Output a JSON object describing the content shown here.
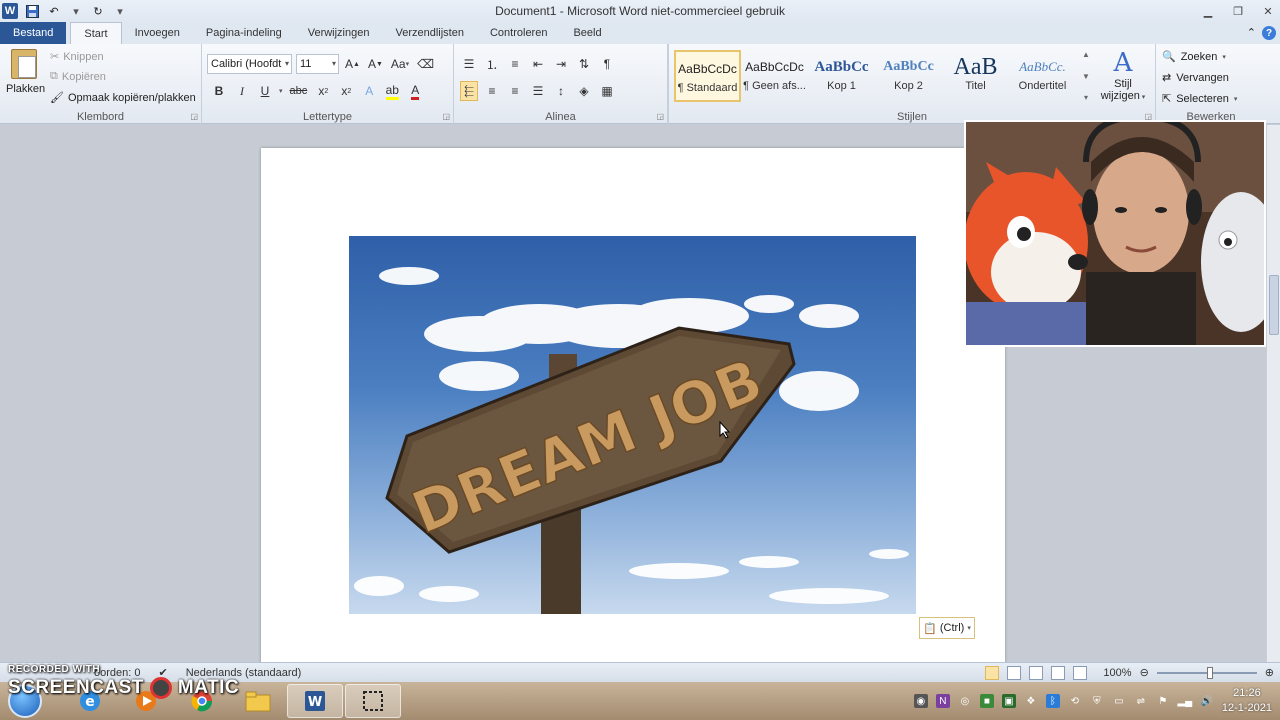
{
  "titlebar": {
    "title": "Document1  -  Microsoft Word niet-commercieel gebruik",
    "logo_letter": "W"
  },
  "tabs": [
    {
      "label": "Bestand"
    },
    {
      "label": "Start"
    },
    {
      "label": "Invoegen"
    },
    {
      "label": "Pagina-indeling"
    },
    {
      "label": "Verwijzingen"
    },
    {
      "label": "Verzendlijsten"
    },
    {
      "label": "Controleren"
    },
    {
      "label": "Beeld"
    }
  ],
  "clipboard": {
    "paste": "Plakken",
    "cut": "Knippen",
    "copy": "Kopiëren",
    "format_painter": "Opmaak kopiëren/plakken",
    "group_label": "Klembord"
  },
  "font": {
    "name": "Calibri (Hoofdt",
    "size": "11",
    "group_label": "Lettertype",
    "change_case": "Aa",
    "bold": "B",
    "italic": "I",
    "underline": "U",
    "strikethrough": "abc",
    "subscript": "x",
    "superscript": "x"
  },
  "paragraph": {
    "group_label": "Alinea",
    "pilcrow": "¶"
  },
  "styles": {
    "group_label": "Stijlen",
    "items": [
      {
        "sample": "AaBbCcDc",
        "name": "¶ Standaard"
      },
      {
        "sample": "AaBbCcDc",
        "name": "¶ Geen afs..."
      },
      {
        "sample": "AaBbCc",
        "name": "Kop 1"
      },
      {
        "sample": "AaBbCc",
        "name": "Kop 2"
      },
      {
        "sample": "AaB",
        "name": "Titel"
      },
      {
        "sample": "AaBbCc.",
        "name": "Ondertitel"
      }
    ],
    "change_styles_1": "Stijl",
    "change_styles_2": "wijzigen"
  },
  "editing": {
    "group_label": "Bewerken",
    "find": "Zoeken",
    "replace": "Vervangen",
    "select": "Selecteren"
  },
  "document": {
    "sign_text": "DREAM JOB",
    "paste_options": "(Ctrl)"
  },
  "statusbar": {
    "watermark_top": "RECORDED WITH",
    "words": "oorden: 0",
    "language": "Nederlands (standaard)",
    "zoom": "100%"
  },
  "watermark": {
    "brand_left": "SCREENCAST",
    "brand_right": "MATIC"
  },
  "taskbar": {
    "time": "21:26",
    "date": "12-1-2021"
  },
  "colors": {
    "file_tab": "#2b5797",
    "selected_highlight": "#fbe3a6",
    "font_color_red": "#d12020",
    "highlight_yellow": "#ffff00"
  }
}
